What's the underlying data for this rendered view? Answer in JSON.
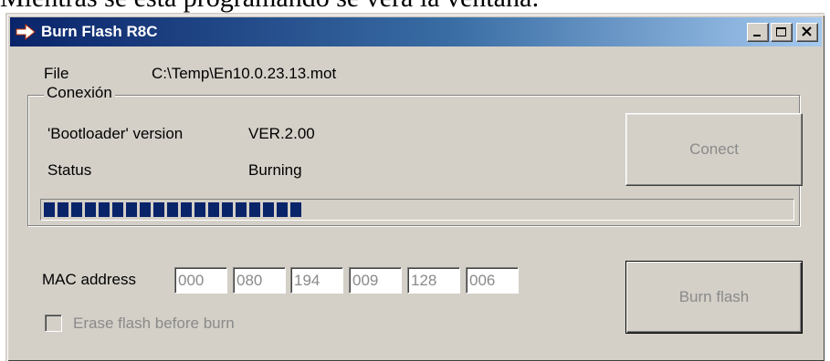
{
  "document": {
    "line_above": "Mientras se está programando se verá la ventana:"
  },
  "window": {
    "title": "Burn Flash R8C",
    "colors": {
      "titlebar_start": "#0a246a",
      "titlebar_end": "#a6caf0",
      "face": "#d4d0c8",
      "progress": "#0a246a"
    }
  },
  "file": {
    "label": "File",
    "path": "C:\\Temp\\En10.0.23.13.mot"
  },
  "connection": {
    "group_title": "Conexión",
    "bootloader_label": "'Bootloader' version",
    "bootloader_value": "VER.2.00",
    "status_label": "Status",
    "status_value": "Burning",
    "connect_button": "Conect",
    "progress_fraction": 0.35
  },
  "mac": {
    "label": "MAC address",
    "octets": [
      "000",
      "080",
      "194",
      "009",
      "128",
      "006"
    ]
  },
  "erase": {
    "label": "Erase flash before burn",
    "checked": false
  },
  "burn_button": "Burn flash"
}
